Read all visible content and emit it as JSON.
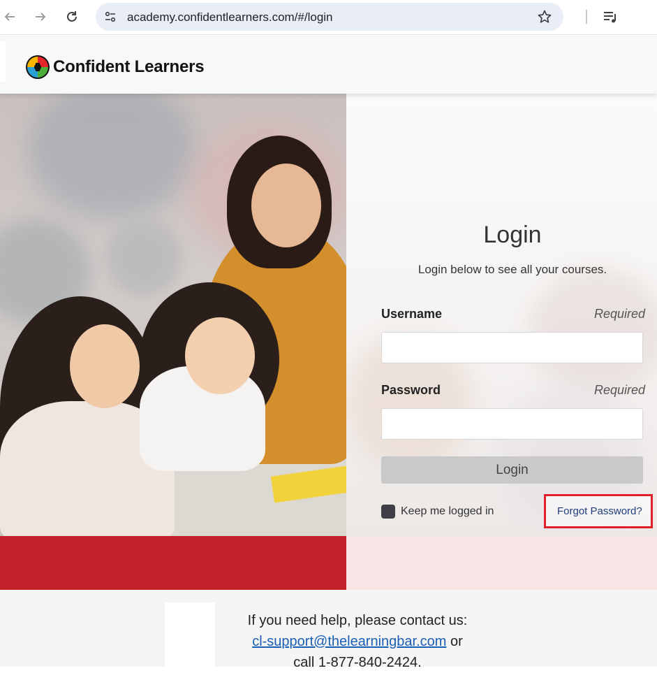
{
  "browser": {
    "url": "academy.confidentlearners.com/#/login",
    "icons": [
      "back-arrow-icon",
      "forward-arrow-icon",
      "reload-icon",
      "site-info-icon",
      "bookmark-star-icon",
      "media-queue-icon"
    ]
  },
  "header": {
    "brand": "Confident Learners",
    "logo_colors": [
      "#e4262c",
      "#f7b500",
      "#2a9fd6",
      "#4caf3a"
    ]
  },
  "login": {
    "title": "Login",
    "subtitle": "Login below to see all your courses.",
    "username_label": "Username",
    "username_required": "Required",
    "username_value": "",
    "password_label": "Password",
    "password_required": "Required",
    "password_value": "",
    "submit_label": "Login",
    "remember_label": "Keep me logged in",
    "remember_checked": true,
    "forgot_label": "Forgot Password?"
  },
  "footer": {
    "help_line": "If you need help, please contact us:",
    "email": "cl-support@thelearningbar.com",
    "or_text": " or",
    "call_text": "call 1-877-840-2424."
  },
  "colors": {
    "accent_red": "#c1222a",
    "band_pink": "#f8e6e6",
    "highlight": "#e0202a",
    "link": "#1f3e7a"
  }
}
